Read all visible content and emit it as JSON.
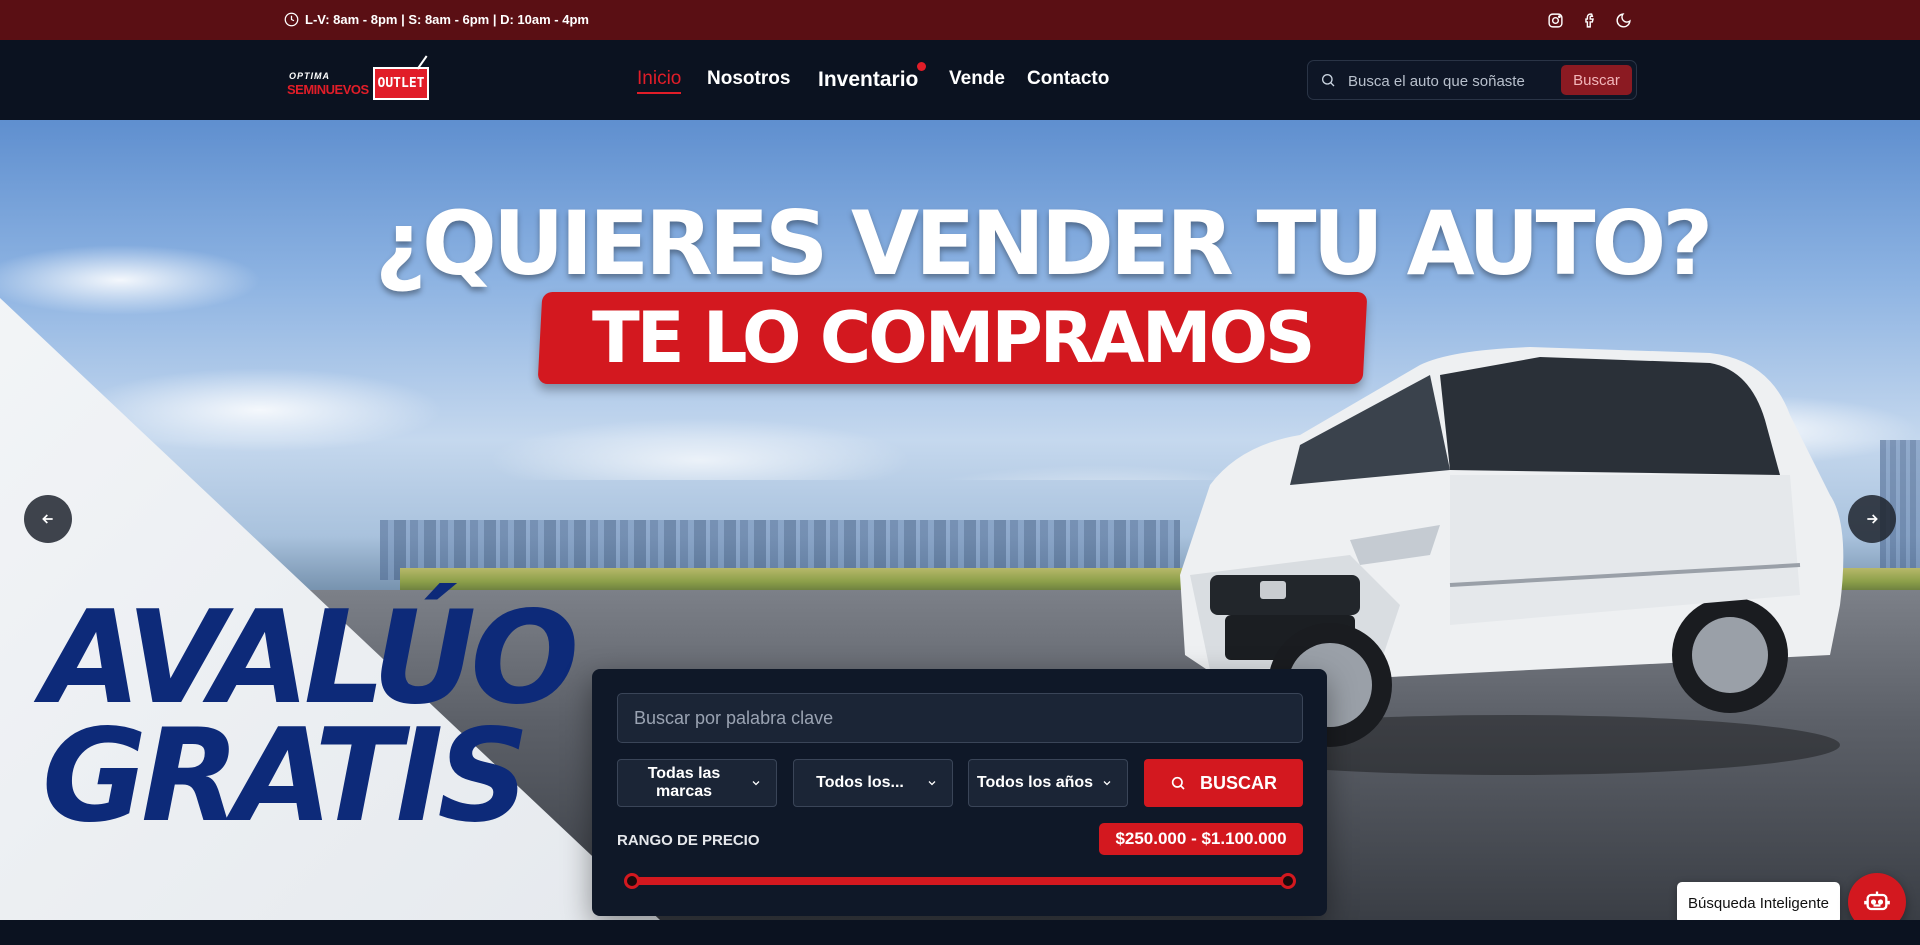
{
  "topbar": {
    "hours": "L-V: 8am - 8pm | S: 8am - 6pm | D: 10am - 4pm",
    "icons": [
      "clock-icon",
      "instagram-icon",
      "facebook-icon",
      "moon-icon"
    ]
  },
  "logo": {
    "optima": "OPTIMA",
    "seminuevos": "SEMINUEVOS",
    "outlet": "OUTLET"
  },
  "nav": {
    "items": [
      {
        "label": "Inicio",
        "active": true
      },
      {
        "label": "Nosotros"
      },
      {
        "label": "Inventario",
        "badge": true
      },
      {
        "label": "Vende"
      },
      {
        "label": "Contacto"
      }
    ],
    "search": {
      "placeholder": "Busca el auto que soñaste",
      "button": "Buscar"
    }
  },
  "hero": {
    "headline": "¿QUIERES VENDER TU AUTO?",
    "ribbon": "TE LO COMPRAMOS",
    "promo_line1": "AVALÚO",
    "promo_line2": "GRATIS"
  },
  "filters": {
    "keyword_placeholder": "Buscar por palabra clave",
    "brand": "Todas las marcas",
    "model": "Todos los...",
    "year": "Todos los años",
    "search_button": "BUSCAR",
    "price_label": "RANGO DE PRECIO",
    "price_value": "$250.000 - $1.100.000",
    "price_range_fraction": [
      0,
      1
    ]
  },
  "smart_search": {
    "label": "Búsqueda Inteligente"
  },
  "colors": {
    "brand_red": "#d3181f",
    "dark": "#0b1220",
    "topbar": "#5a0f14",
    "promo_blue": "#0d2a79"
  }
}
